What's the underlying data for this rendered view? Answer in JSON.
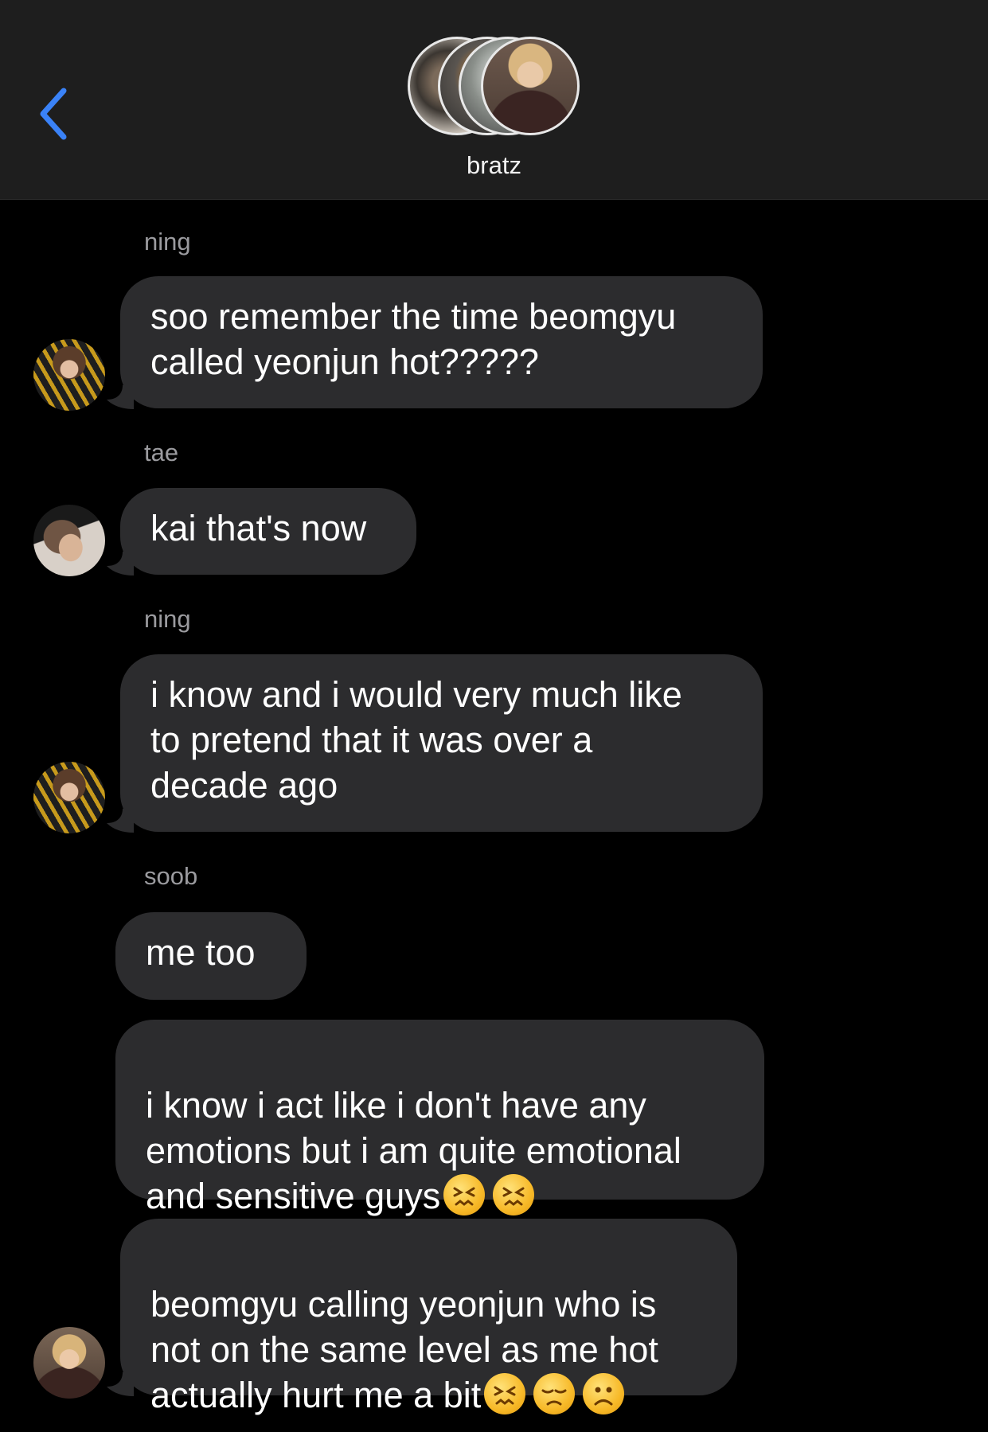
{
  "header": {
    "title": "bratz",
    "back_icon": "chevron-left-icon",
    "accent_color": "#3a82f7",
    "group_avatars": [
      "member-avatar-1",
      "member-avatar-2",
      "member-avatar-3",
      "member-avatar-4"
    ]
  },
  "messages": [
    {
      "sender": "ning",
      "text": "soo remember the time beomgyu\ncalled yeonjun hot?????"
    },
    {
      "sender": "tae",
      "text": "kai that's now"
    },
    {
      "sender": "ning",
      "text": "i know and i would very much like\nto pretend that it was over a\ndecade ago"
    },
    {
      "sender": "soob",
      "text": "me too"
    },
    {
      "text": "i know i act like i don't have any\nemotions but i am quite emotional\nand sensitive guys",
      "emojis": [
        "confounded-face-icon",
        "confounded-face-icon"
      ]
    },
    {
      "text": "beomgyu calling yeonjun who is\nnot on the same level as me hot\nactually hurt me a bit",
      "emojis": [
        "confounded-face-icon",
        "disappointed-face-icon",
        "frowning-face-icon"
      ]
    }
  ],
  "colors": {
    "background": "#000000",
    "header_background": "#1e1e1e",
    "bubble": "#2c2c2e",
    "sender_label": "#9b9b9f"
  }
}
